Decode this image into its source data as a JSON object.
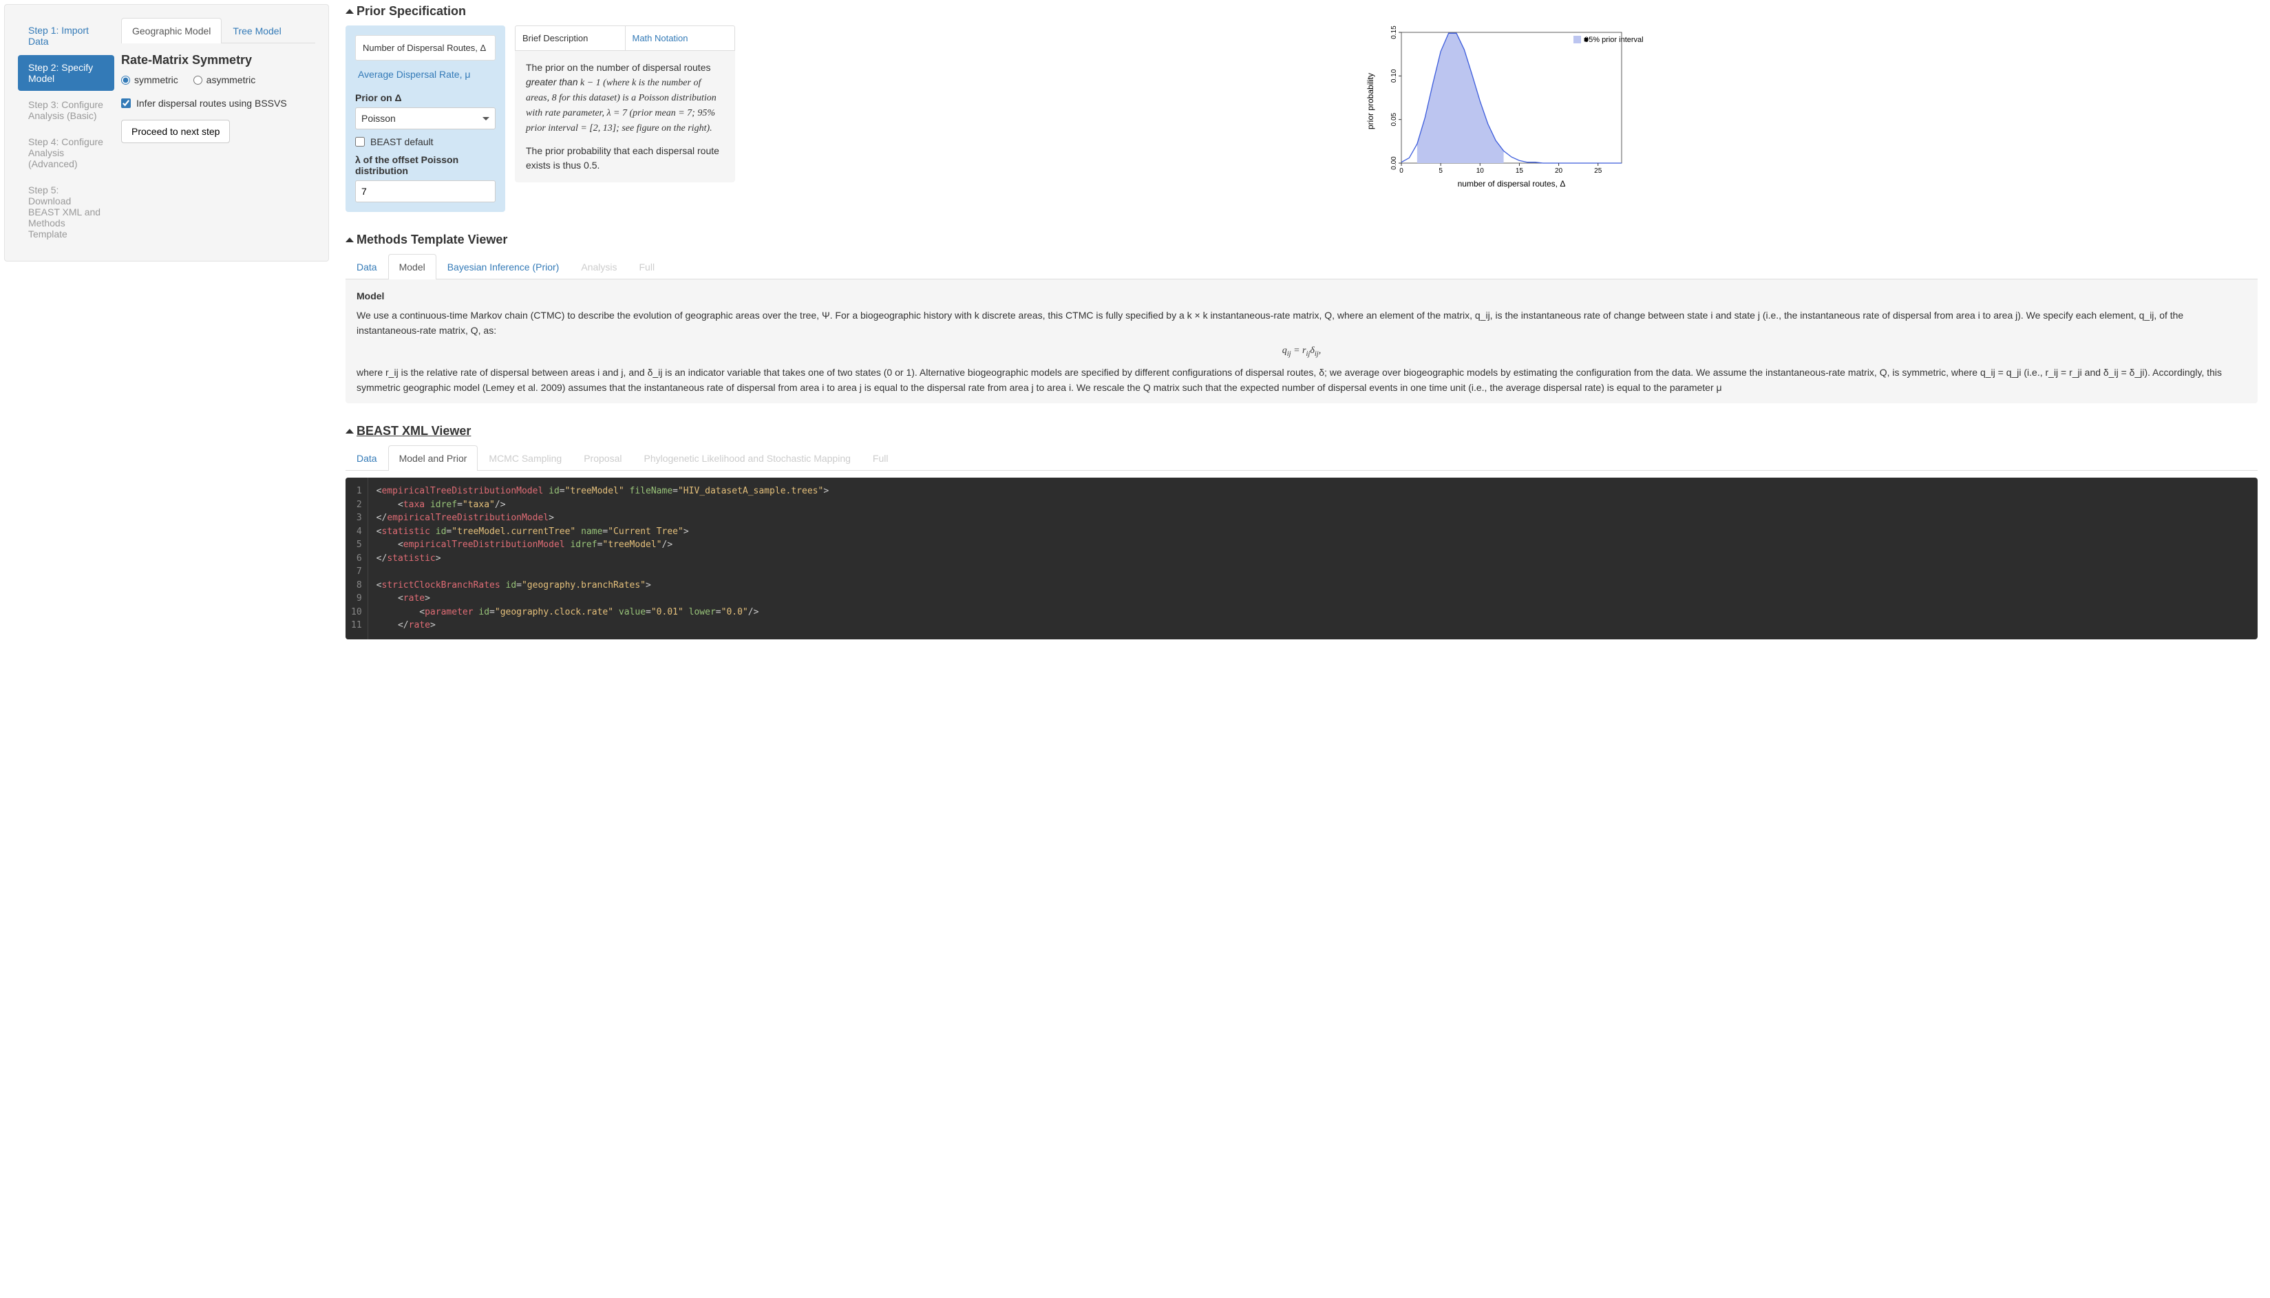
{
  "sidebar": {
    "steps": [
      "Step 1: Import Data",
      "Step 2: Specify Model",
      "Step 3: Configure Analysis (Basic)",
      "Step 4: Configure Analysis (Advanced)",
      "Step 5: Download BEAST XML and Methods Template"
    ],
    "tabs": {
      "geo": "Geographic Model",
      "tree": "Tree Model"
    },
    "symmetry_hdr": "Rate-Matrix Symmetry",
    "sym_opt": "symmetric",
    "asym_opt": "asymmetric",
    "bssvs": "Infer dispersal routes using BSSVS",
    "proceed": "Proceed to next step"
  },
  "prior": {
    "hdr": "Prior Specification",
    "tab_routes": "Number of Dispersal Routes, Δ",
    "tab_rate": "Average Dispersal Rate, μ",
    "lbl_prior_on": "Prior on Δ",
    "sel_val": "Poisson",
    "chk_default": "BEAST default",
    "lbl_lambda": "λ of the offset Poisson distribution",
    "lambda_val": "7",
    "desc_tab_brief": "Brief Description",
    "desc_tab_math": "Math Notation",
    "desc_p1a": "The prior on the number of dispersal routes ",
    "desc_p1b": "greater than",
    "desc_p1c": " k − 1 (where k is the number of areas, 8 for this dataset) is a Poisson distribution with rate parameter, λ = 7 (prior mean = 7; 95% prior interval = [2, 13]; see figure on the right).",
    "desc_p2": "The prior probability that each dispersal route exists is thus 0.5.",
    "plot_ylabel": "prior probability",
    "plot_xlabel": "number of dispersal routes, Δ",
    "plot_legend": "95% prior interval",
    "plot_yticks": [
      "0.00",
      "0.05",
      "0.10",
      "0.15"
    ],
    "plot_xticks": [
      "0",
      "5",
      "10",
      "15",
      "20",
      "25"
    ]
  },
  "chart_data": {
    "type": "area",
    "title": "",
    "xlabel": "number of dispersal routes, Δ",
    "ylabel": "prior probability",
    "xlim": [
      0,
      28
    ],
    "ylim": [
      0,
      0.15
    ],
    "x": [
      0,
      1,
      2,
      3,
      4,
      5,
      6,
      7,
      8,
      9,
      10,
      11,
      12,
      13,
      14,
      15,
      16,
      17,
      18,
      19,
      20,
      21,
      22,
      23,
      24,
      25,
      26,
      27,
      28
    ],
    "values": [
      0.001,
      0.006,
      0.022,
      0.052,
      0.091,
      0.128,
      0.149,
      0.149,
      0.13,
      0.101,
      0.071,
      0.045,
      0.026,
      0.014,
      0.007,
      0.003,
      0.001,
      0.001,
      0.0,
      0.0,
      0.0,
      0.0,
      0.0,
      0.0,
      0.0,
      0.0,
      0.0,
      0.0,
      0.0
    ],
    "shaded_interval": [
      2,
      13
    ],
    "legend": "95% prior interval"
  },
  "methods": {
    "hdr": "Methods Template Viewer",
    "tabs": [
      "Data",
      "Model",
      "Bayesian Inference (Prior)",
      "Analysis",
      "Full"
    ],
    "panel_hdr": "Model",
    "body": "We use a continuous-time Markov chain (CTMC) to describe the evolution of geographic areas over the tree, Ψ. For a biogeographic history with k discrete areas, this CTMC is fully specified by a k × k instantaneous-rate matrix, Q, where an element of the matrix, q_ij, is the instantaneous rate of change between state i and state j (i.e., the instantaneous rate of dispersal from area i to area j). We specify each element, q_ij, of the instantaneous-rate matrix, Q, as:",
    "eq": "q_{ij} = r_{ij} δ_{ij},",
    "body2": "where r_ij is the relative rate of dispersal between areas i and j, and δ_ij is an indicator variable that takes one of two states (0 or 1). Alternative biogeographic models are specified by different configurations of dispersal routes, δ; we average over biogeographic models by estimating the configuration from the data. We assume the instantaneous-rate matrix, Q, is symmetric, where q_ij = q_ji (i.e., r_ij = r_ji and δ_ij = δ_ji). Accordingly, this symmetric geographic model (Lemey et al. 2009) assumes that the instantaneous rate of dispersal from area i to area j is equal to the dispersal rate from area j to area i. We rescale the Q matrix such that the expected number of dispersal events in one time unit (i.e., the average dispersal rate) is equal to the parameter μ"
  },
  "xml": {
    "hdr": "BEAST XML Viewer",
    "tabs": [
      "Data",
      "Model and Prior",
      "MCMC Sampling",
      "Proposal",
      "Phylogenetic Likelihood and Stochastic Mapping",
      "Full"
    ],
    "lines": [
      {
        "n": 1,
        "html": "&lt;<span class='tag'>empiricalTreeDistributionModel</span> <span class='attr'>id</span>=<span class='val'>\"treeModel\"</span> <span class='attr'>fileName</span>=<span class='val'>\"HIV_datasetA_sample.trees\"</span>&gt;"
      },
      {
        "n": 2,
        "html": "    &lt;<span class='tag'>taxa</span> <span class='attr'>idref</span>=<span class='val'>\"taxa\"</span>/&gt;"
      },
      {
        "n": 3,
        "html": "&lt;/<span class='tag'>empiricalTreeDistributionModel</span>&gt;"
      },
      {
        "n": 4,
        "html": "&lt;<span class='tag'>statistic</span> <span class='attr'>id</span>=<span class='val'>\"treeModel.currentTree\"</span> <span class='attr'>name</span>=<span class='val'>\"Current Tree\"</span>&gt;"
      },
      {
        "n": 5,
        "html": "    &lt;<span class='tag'>empiricalTreeDistributionModel</span> <span class='attr'>idref</span>=<span class='val'>\"treeModel\"</span>/&gt;"
      },
      {
        "n": 6,
        "html": "&lt;/<span class='tag'>statistic</span>&gt;"
      },
      {
        "n": 7,
        "html": ""
      },
      {
        "n": 8,
        "html": "&lt;<span class='tag'>strictClockBranchRates</span> <span class='attr'>id</span>=<span class='val'>\"geography.branchRates\"</span>&gt;"
      },
      {
        "n": 9,
        "html": "    &lt;<span class='tag'>rate</span>&gt;"
      },
      {
        "n": 10,
        "html": "        &lt;<span class='tag'>parameter</span> <span class='attr'>id</span>=<span class='val'>\"geography.clock.rate\"</span> <span class='attr'>value</span>=<span class='val'>\"0.01\"</span> <span class='attr'>lower</span>=<span class='val'>\"0.0\"</span>/&gt;"
      },
      {
        "n": 11,
        "html": "    &lt;/<span class='tag'>rate</span>&gt;"
      }
    ]
  }
}
